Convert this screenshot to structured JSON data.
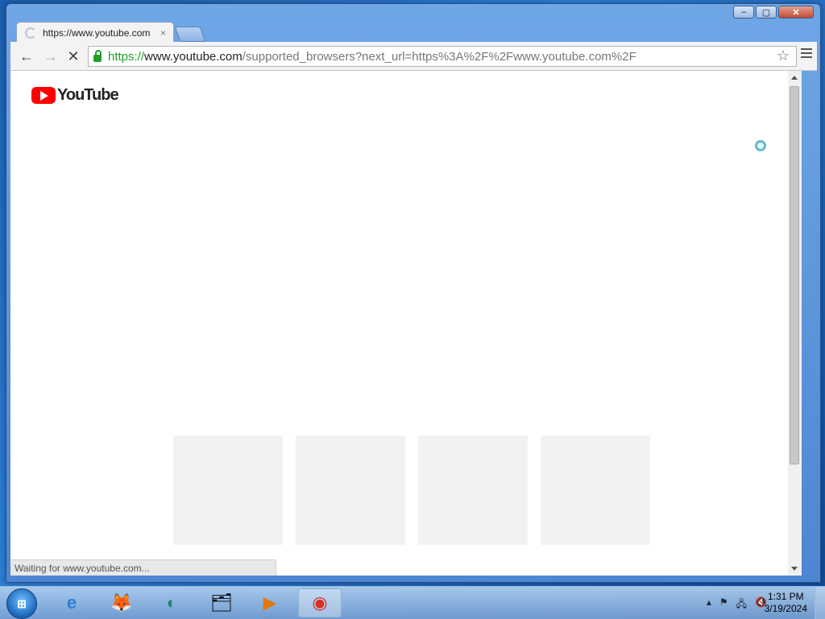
{
  "window": {
    "controls": [
      "–",
      "▢",
      "✕"
    ]
  },
  "tab": {
    "title": "https://www.youtube.com",
    "close": "×"
  },
  "toolbar": {
    "back": "←",
    "forward": "→",
    "stop": "✕",
    "url_scheme": "https://",
    "url_host": "www.youtube.com",
    "url_path": "/supported_browsers?next_url=https%3A%2F%2Fwww.youtube.com%2F",
    "star": "☆"
  },
  "page": {
    "logo_text": "YouTube",
    "status_text": "Waiting for www.youtube.com..."
  },
  "taskbar": {
    "start": "⊞",
    "apps": [
      {
        "name": "internet-explorer",
        "glyph": "e"
      },
      {
        "name": "firefox",
        "glyph": "🦊"
      },
      {
        "name": "edge",
        "glyph": "◐"
      },
      {
        "name": "file-explorer",
        "glyph": "🗂"
      },
      {
        "name": "media-player",
        "glyph": "▶"
      },
      {
        "name": "chrome",
        "glyph": "◉"
      }
    ],
    "tray": [
      "▴",
      "⚑",
      "🖧",
      "🔇"
    ],
    "time": "1:31 PM",
    "date": "3/19/2024"
  },
  "colors": {
    "brand_red": "#ff0000",
    "secure_green": "#1f9e2b"
  }
}
